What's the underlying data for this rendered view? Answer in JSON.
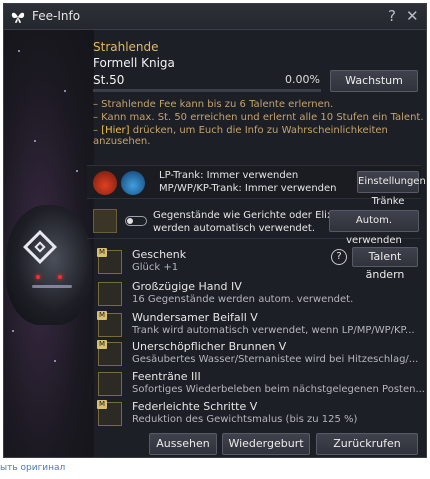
{
  "window": {
    "title": "Fee-Info",
    "help_label": "?",
    "close_label": "✕"
  },
  "fairy": {
    "type": "Strahlende",
    "name": "Formell Kniga",
    "level": "St.50",
    "exp_percent_text": "0.00%",
    "exp_progress": 0.0,
    "growth_button": "Wachstum"
  },
  "notes": {
    "line1": "– Strahlende Fee kann bis zu 6 Talente erlernen.",
    "line2": "– Kann max. St. 50 erreichen und erlernt alle 10 Stufen ein Talent.",
    "line3_prefix": "– ",
    "line3_highlight": "[Hier]",
    "line3_suffix": " drücken, um Euch die Info zu Wahrscheinlichkeiten anzusehen."
  },
  "potions": {
    "lp_text": "LP-Trank: Immer verwenden",
    "mp_text": "MP/WP/KP-Trank: Immer verwenden",
    "settings_button": "Einstellungen Tränke"
  },
  "food": {
    "line1": "Gegenstände wie Gerichte oder Elixiere",
    "line2": "werden automatisch verwendet.",
    "auto_button": "Autom. verwenden"
  },
  "talent_help": "?",
  "talent_change_button": "Talent ändern",
  "talents": [
    {
      "name": "Geschenk",
      "desc": "Glück +1",
      "badge": "M"
    },
    {
      "name": "Großzügige Hand IV",
      "desc": "16 Gegenstände werden autom. verwendet.",
      "badge": ""
    },
    {
      "name": "Wundersamer Beifall V",
      "desc": "Trank wird automatisch verwendet, wenn LP/MP/WP/KP...",
      "badge": "M"
    },
    {
      "name": "Unerschöpflicher Brunnen V",
      "desc": "Gesäubertes Wasser/Sternanistee wird bei Hitzeschlag/...",
      "badge": "M"
    },
    {
      "name": "Feenträne III",
      "desc": "Sofortiges Wiederbeleben beim nächstgelegenen Posten...",
      "badge": ""
    },
    {
      "name": "Federleichte Schritte V",
      "desc": "Reduktion des Gewichtsmalus (bis zu 125 %)",
      "badge": "M"
    }
  ],
  "bottom": {
    "appearance": "Aussehen",
    "rebirth": "Wiedergeburt",
    "recall": "Zurückrufen"
  },
  "footer_link": "ыть оригинал",
  "colors": {
    "accent_gold": "#e0b96a",
    "highlight": "#f0c040",
    "bg": "#1c1e24"
  }
}
